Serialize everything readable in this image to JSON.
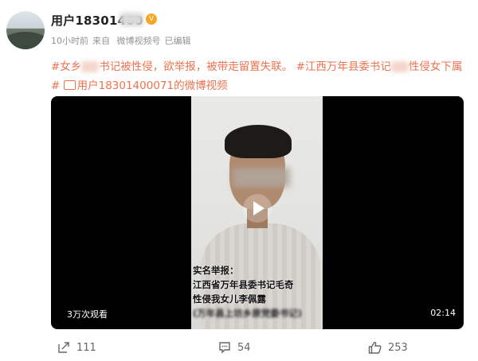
{
  "post": {
    "username": "用户18301400",
    "meta": {
      "time": "10小时前",
      "source_prefix": "来自",
      "source": "微博视频号",
      "edited": "已编辑"
    },
    "text": {
      "tag1_start": "#女乡",
      "tag1_end": "书记被性侵，欲举报，被带走留置失联。",
      "tag2_start": "#江西万年县委书记",
      "tag2_end": "性侵女下属#",
      "video_link": "用户18301400071的微博视频"
    }
  },
  "video": {
    "caption_lines": [
      "实名举报：",
      "江西省万年县委书记毛奇",
      "性侵我女儿李佩露",
      "(万年县上坊乡原党委书记)"
    ],
    "views": "3万次观看",
    "duration": "02:14"
  },
  "actions": {
    "share_count": "111",
    "comment_count": "54",
    "like_count": "253"
  }
}
